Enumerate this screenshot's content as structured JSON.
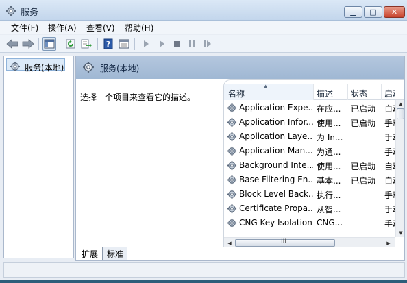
{
  "window": {
    "title": "服务",
    "controls": {
      "minimize": "▁",
      "maximize": "□",
      "close": "✕"
    }
  },
  "menu": [
    "文件(F)",
    "操作(A)",
    "查看(V)",
    "帮助(H)"
  ],
  "toolbar": {
    "icons": [
      "back-arrow-icon",
      "forward-arrow-icon",
      "show-hide-tree-icon",
      "refresh-icon",
      "export-list-icon",
      "help-icon",
      "properties-icon",
      "start-service-icon",
      "start-service-alt-icon",
      "stop-service-icon",
      "pause-service-icon",
      "restart-service-icon"
    ]
  },
  "tree": {
    "label": "服务(本地)",
    "icon": "gear-icon"
  },
  "panel": {
    "title": "服务(本地)",
    "description": "选择一个项目来查看它的描述。"
  },
  "list": {
    "columns": {
      "name": "名称",
      "desc": "描述",
      "status": "状态",
      "startup": "启动"
    },
    "rows": [
      {
        "name": "Application Expe...",
        "desc": "在应...",
        "status": "已启动",
        "startup": "自动"
      },
      {
        "name": "Application Infor...",
        "desc": "使用...",
        "status": "已启动",
        "startup": "手动"
      },
      {
        "name": "Application Laye...",
        "desc": "为 In...",
        "status": "",
        "startup": "手动"
      },
      {
        "name": "Application Man...",
        "desc": "为通...",
        "status": "",
        "startup": "手动"
      },
      {
        "name": "Background Inte...",
        "desc": "使用...",
        "status": "已启动",
        "startup": "自动"
      },
      {
        "name": "Base Filtering En...",
        "desc": "基本...",
        "status": "已启动",
        "startup": "自动"
      },
      {
        "name": "Block Level Back...",
        "desc": "执行...",
        "status": "",
        "startup": "手动"
      },
      {
        "name": "Certificate Propa...",
        "desc": "从智...",
        "status": "",
        "startup": "手动"
      },
      {
        "name": "CNG Key Isolation",
        "desc": "CNG...",
        "status": "",
        "startup": "手动"
      }
    ]
  },
  "tabs": [
    "扩展",
    "标准"
  ],
  "scroll": {
    "hgrip": "III"
  }
}
